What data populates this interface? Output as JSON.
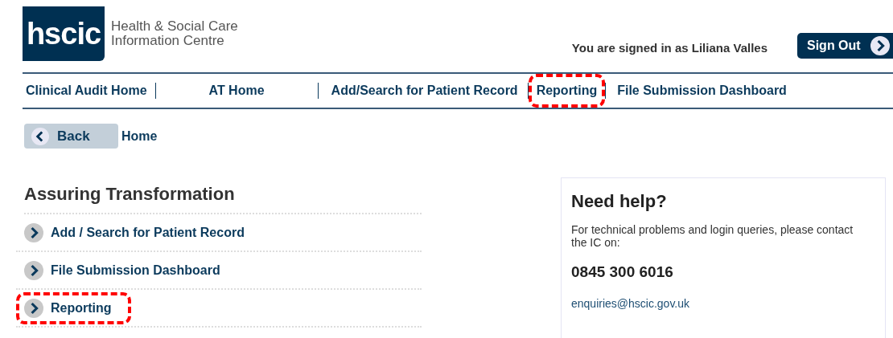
{
  "logo": {
    "mark": "hscic",
    "line_1": "Health & Social Care",
    "line_2": "Information Centre"
  },
  "user": {
    "signed_in_text": "You are signed in as Liliana Valles",
    "sign_out": "Sign Out"
  },
  "nav": [
    {
      "label": "Clinical Audit Home",
      "highlighted": false
    },
    {
      "label": "AT Home",
      "highlighted": false
    },
    {
      "label": "Add/Search for Patient Record",
      "highlighted": false
    },
    {
      "label": "Reporting",
      "highlighted": true
    },
    {
      "label": "File Submission Dashboard",
      "highlighted": false
    }
  ],
  "breadcrumb": {
    "back": "Back",
    "current": "Home"
  },
  "section": {
    "title": "Assuring Transformation",
    "links": [
      {
        "label": "Add / Search for Patient Record",
        "highlighted": false
      },
      {
        "label": "File Submission Dashboard",
        "highlighted": false
      },
      {
        "label": "Reporting",
        "highlighted": true
      }
    ]
  },
  "help": {
    "title": "Need help?",
    "text": "For technical problems and login queries, please contact the IC on:",
    "phone": "0845 300 6016",
    "email": "enquiries@hscic.gov.uk"
  }
}
